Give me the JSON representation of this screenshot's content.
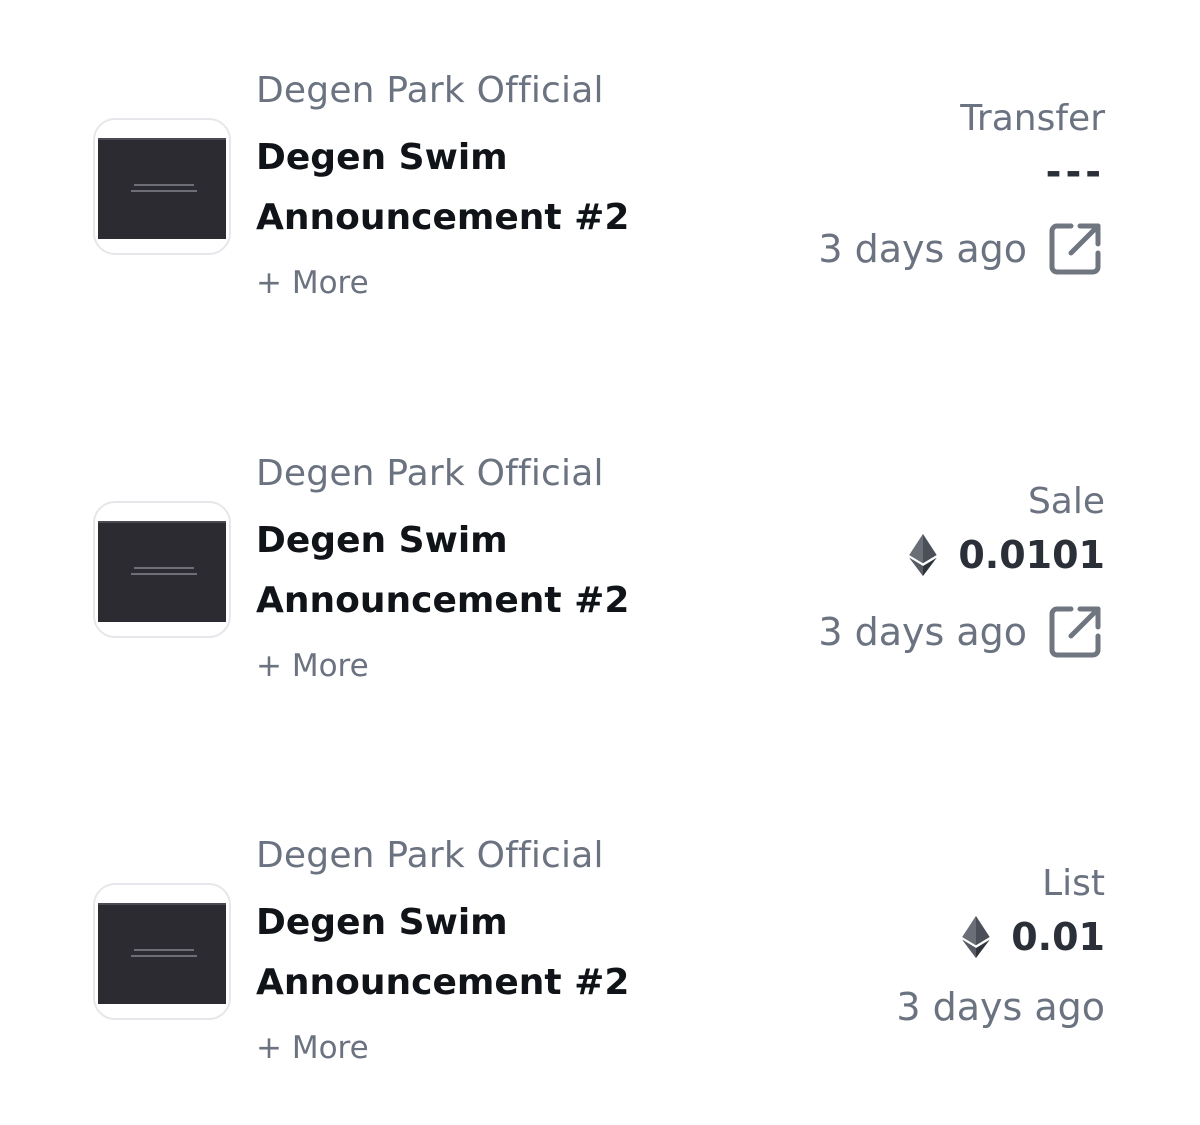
{
  "activity": [
    {
      "collection": "Degen Park Official",
      "title_line1": "Degen Swim",
      "title_line2": "Announcement #2",
      "more_label": "+ More",
      "event_type": "Transfer",
      "price": "---",
      "time": "3 days ago",
      "icon": "external-link-icon"
    },
    {
      "collection": "Degen Park Official",
      "title_line1": "Degen Swim",
      "title_line2": "Announcement #2",
      "more_label": "+ More",
      "event_type": "Sale",
      "price": "0.0101",
      "time": "3 days ago",
      "icon": "external-link-icon"
    },
    {
      "collection": "Degen Park Official",
      "title_line1": "Degen Swim",
      "title_line2": "Announcement #2",
      "more_label": "+ More",
      "event_type": "List",
      "price": "0.01",
      "time": "3 days ago"
    }
  ],
  "colors": {
    "muted_text": "#6b7280",
    "title_text": "#101418",
    "price_text": "#2a2f38",
    "icon_gray": "#6f7680"
  }
}
